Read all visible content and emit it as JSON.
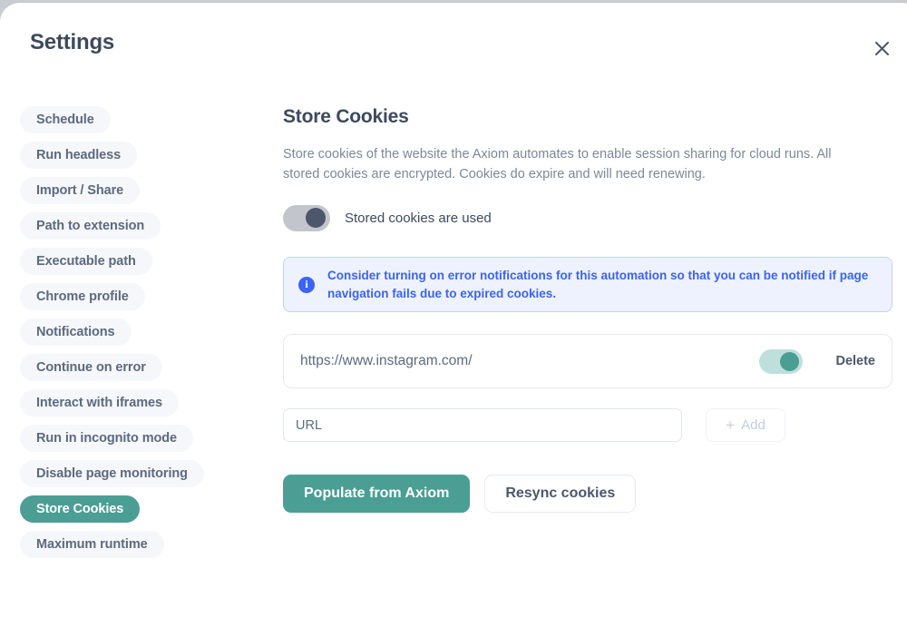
{
  "header": {
    "title": "Settings",
    "close_icon": "close-icon"
  },
  "sidebar": {
    "items": [
      {
        "label": "Schedule",
        "active": false
      },
      {
        "label": "Run headless",
        "active": false
      },
      {
        "label": "Import / Share",
        "active": false
      },
      {
        "label": "Path to extension",
        "active": false
      },
      {
        "label": "Executable path",
        "active": false
      },
      {
        "label": "Chrome profile",
        "active": false
      },
      {
        "label": "Notifications",
        "active": false
      },
      {
        "label": "Continue on error",
        "active": false
      },
      {
        "label": "Interact with iframes",
        "active": false
      },
      {
        "label": "Run in incognito mode",
        "active": false
      },
      {
        "label": "Disable page monitoring",
        "active": false
      },
      {
        "label": "Store Cookies",
        "active": true
      },
      {
        "label": "Maximum runtime",
        "active": false
      }
    ]
  },
  "main": {
    "title": "Store Cookies",
    "description": "Store cookies of the website the Axiom automates to enable session sharing for cloud runs. All stored cookies are encrypted. Cookies do expire and will need renewing.",
    "stored_toggle": {
      "label": "Stored cookies are used",
      "state": "on"
    },
    "info_banner": {
      "icon": "info-icon",
      "icon_glyph": "i",
      "text": "Consider turning on error notifications for this automation so that you can be notified if page navigation fails due to expired cookies."
    },
    "cookies": [
      {
        "url": "https://www.instagram.com/",
        "enabled": "on",
        "delete_label": "Delete"
      }
    ],
    "add_row": {
      "input_value": "",
      "input_placeholder": "URL",
      "add_label": "Add",
      "add_plus": "+",
      "add_disabled": true
    },
    "actions": {
      "primary_label": "Populate from Axiom",
      "secondary_label": "Resync cookies"
    }
  },
  "colors": {
    "accent_teal": "#4a9e94",
    "info_blue": "#3b63f6",
    "text_dark": "#3c4a5e",
    "text_muted": "#7c8899",
    "pill_bg": "#f6f7fa",
    "page_bg": "#c9ccd1"
  }
}
